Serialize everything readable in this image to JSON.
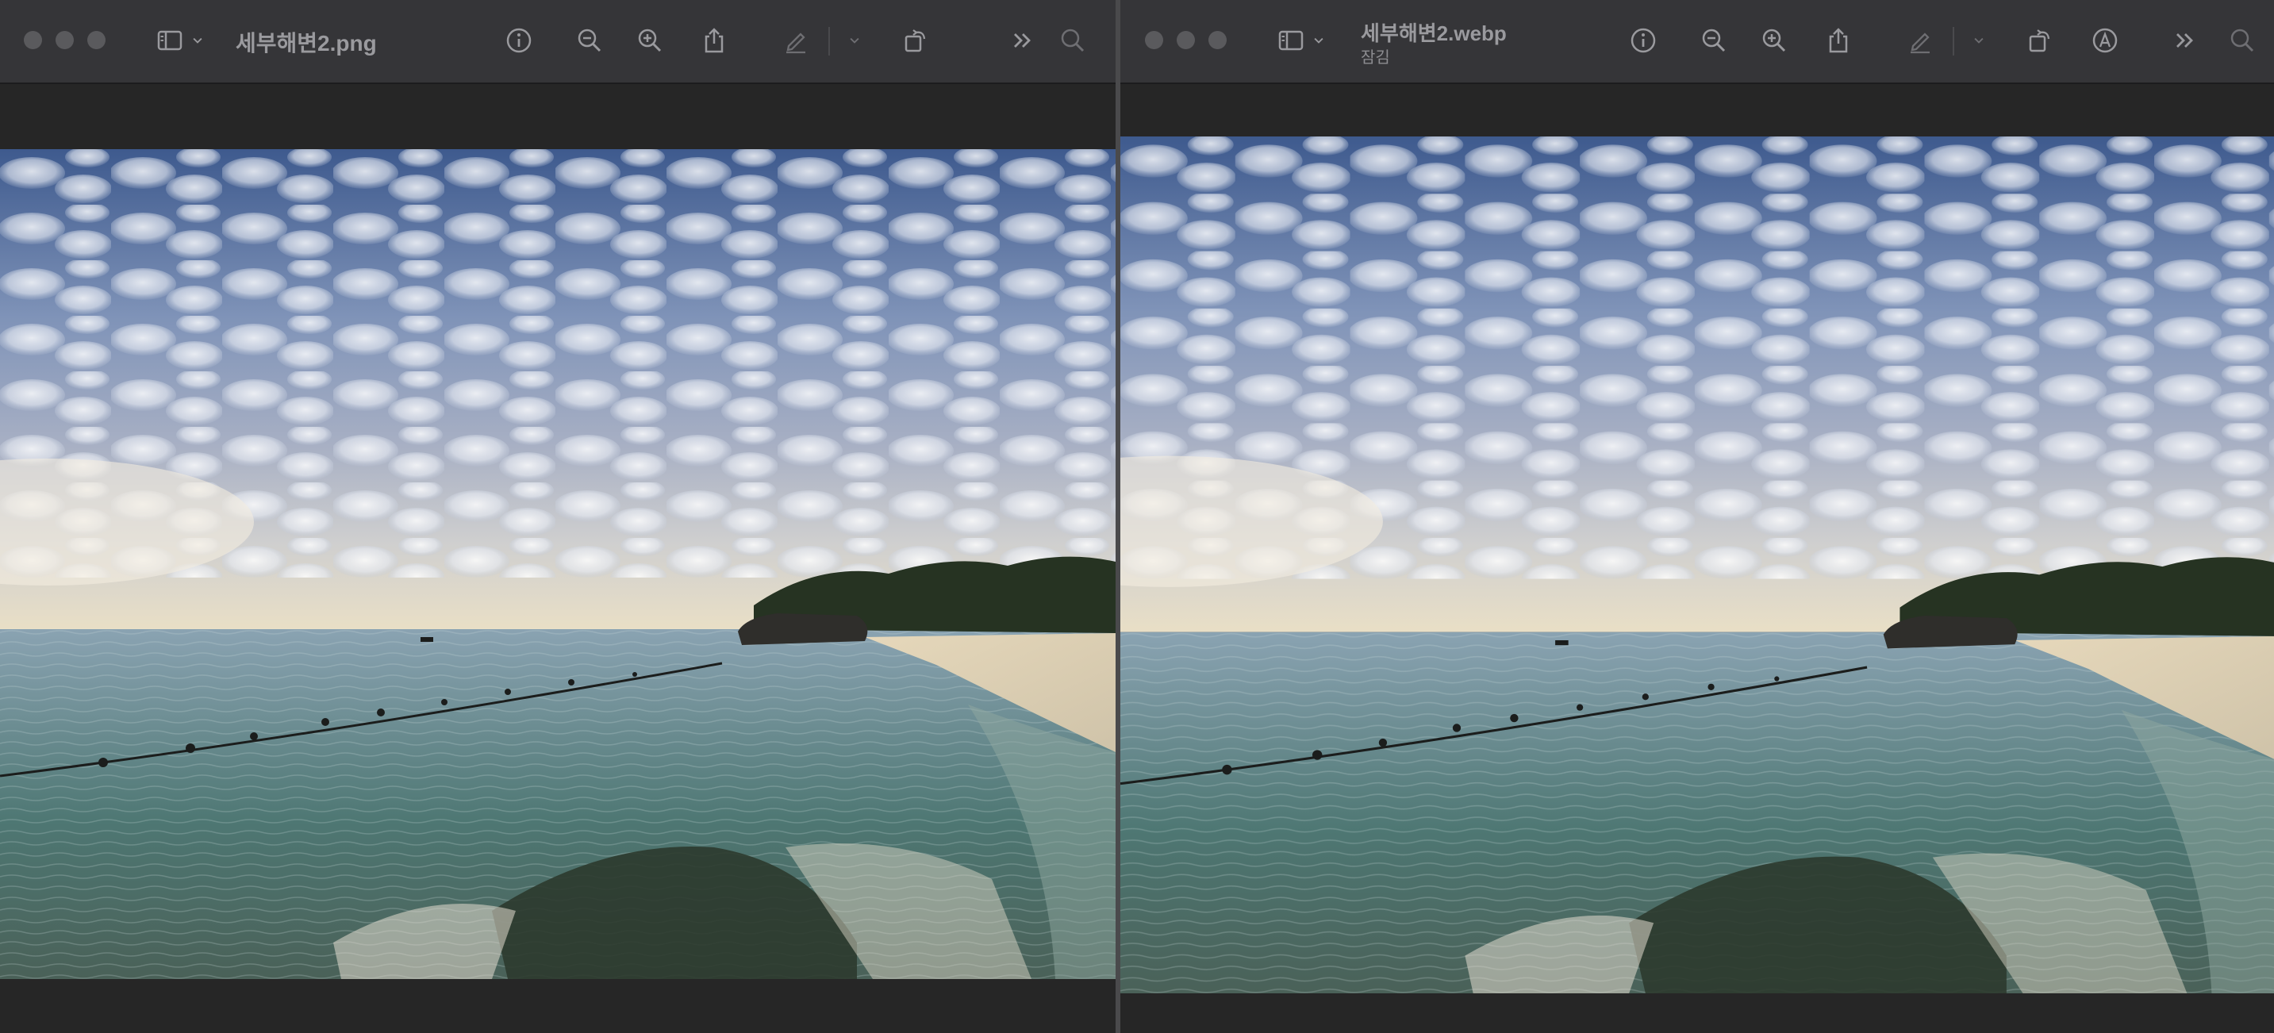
{
  "left_window": {
    "title": "세부해변2.png",
    "icons": [
      "sidebar-toggle-icon",
      "chevron-down-icon",
      "info-icon",
      "zoom-out-icon",
      "zoom-in-icon",
      "share-icon",
      "markup-pen-icon",
      "chevron-down-icon",
      "rotate-icon",
      "more-chevrons-icon",
      "search-icon"
    ]
  },
  "right_window": {
    "title": "세부해변2.webp",
    "subtitle": "잠김",
    "icons": [
      "sidebar-toggle-icon",
      "chevron-down-icon",
      "info-icon",
      "zoom-out-icon",
      "zoom-in-icon",
      "share-icon",
      "markup-pen-icon",
      "chevron-down-icon",
      "rotate-icon",
      "accessibility-markup-icon",
      "more-chevrons-icon",
      "search-icon"
    ]
  },
  "colors": {
    "titlebar": "#353538",
    "background": "#262626",
    "icon": "#9a9a9e",
    "sky_top": "#3f5b8f",
    "sea": "#4f7c7a",
    "sand": "#ddd0b3"
  }
}
